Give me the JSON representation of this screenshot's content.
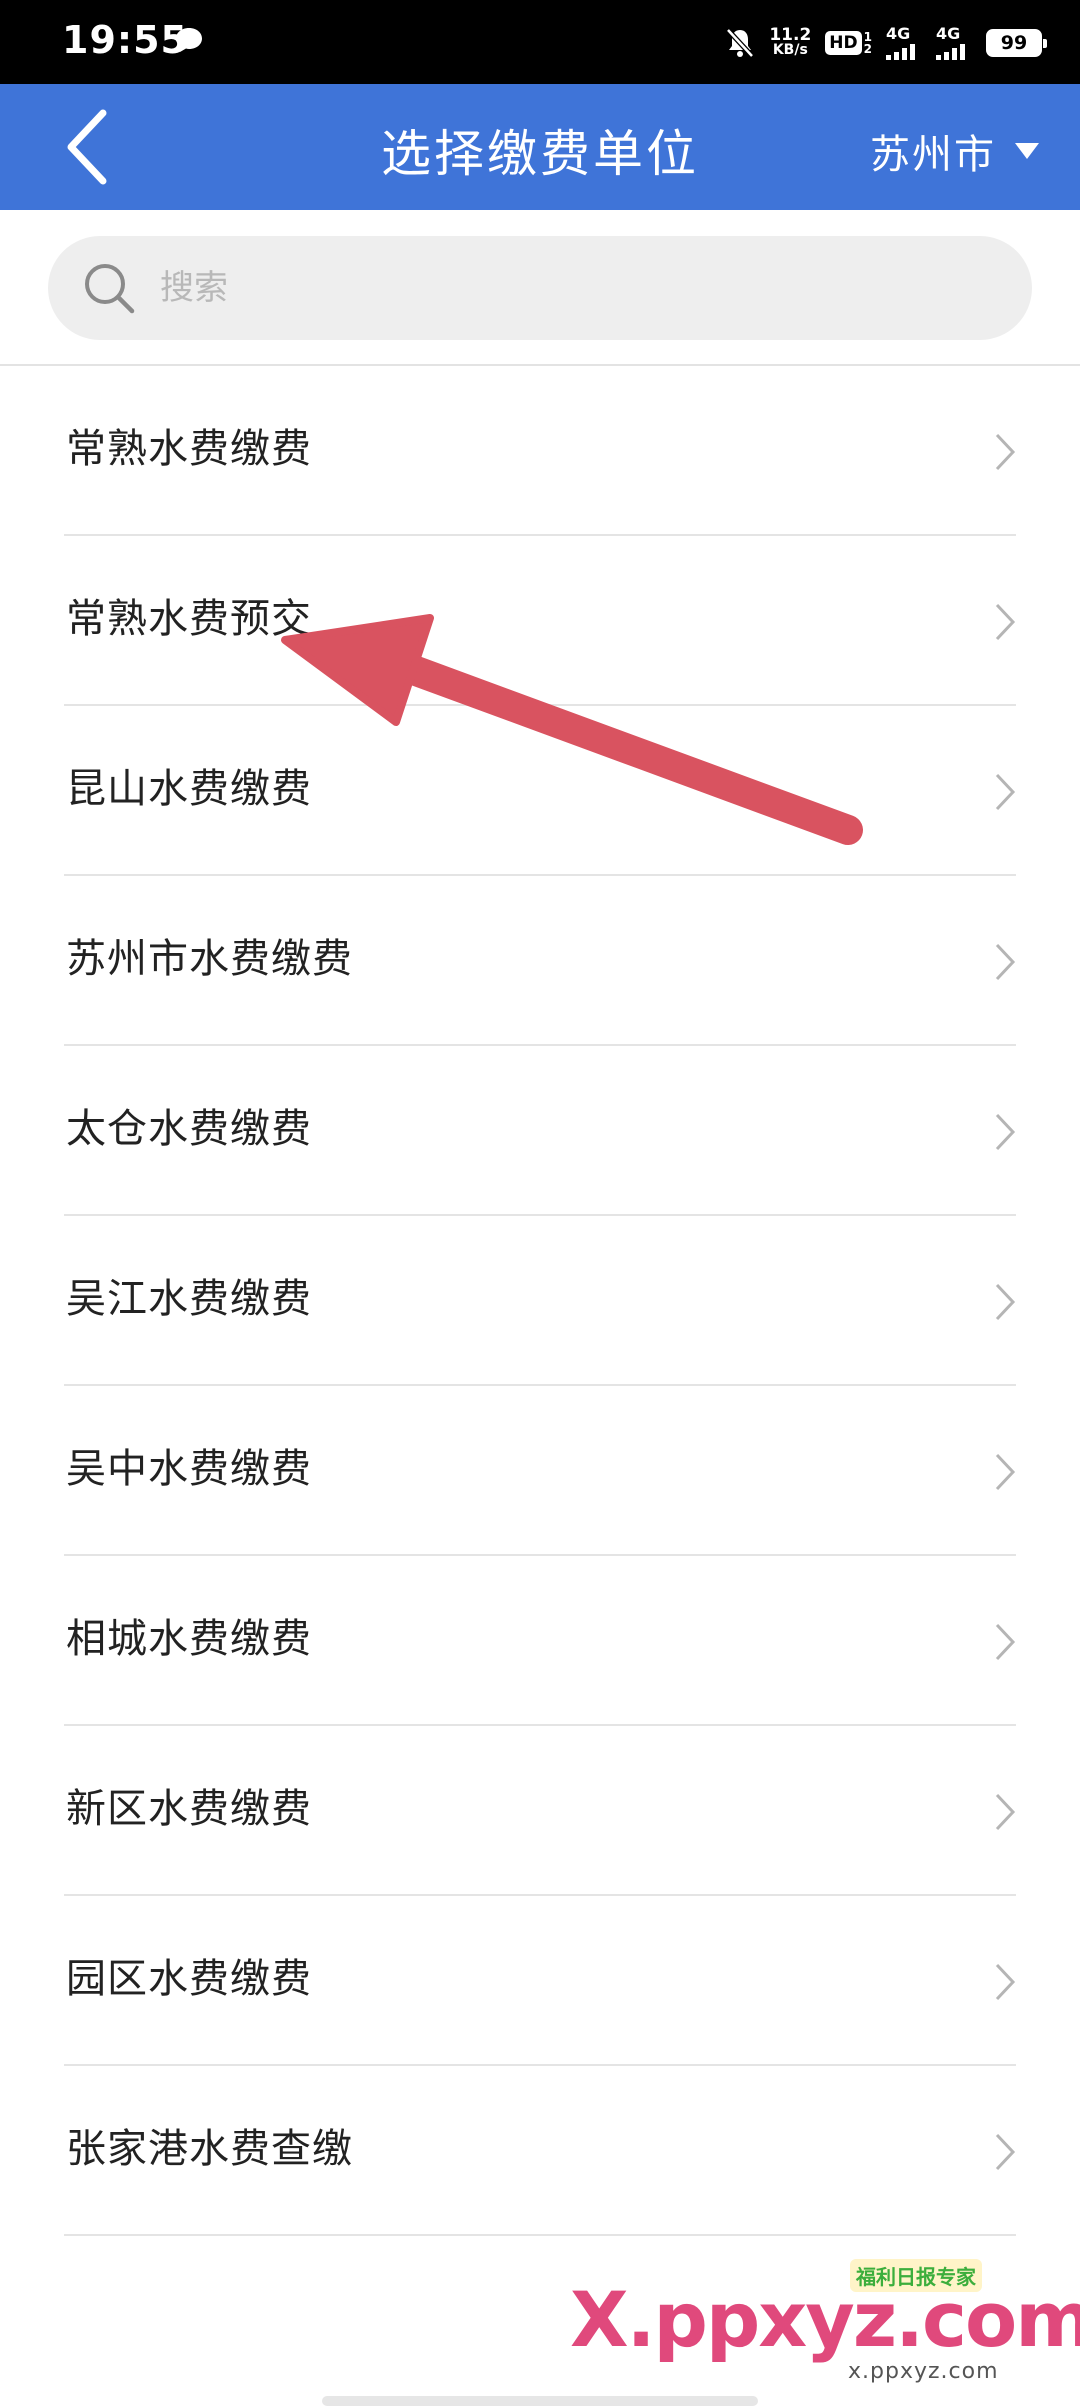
{
  "status_bar": {
    "time": "19:55",
    "speed_value": "11.2",
    "speed_unit": "KB/s",
    "hd_label": "HD",
    "hd_sub_top": "1",
    "hd_sub_bottom": "2",
    "net1_label": "4G",
    "net2_label": "4G",
    "battery": "99",
    "icons": [
      "chat-bubble-icon",
      "mute-bell-icon",
      "signal-icon",
      "signal-icon",
      "battery-icon"
    ]
  },
  "header": {
    "title": "选择缴费单位",
    "city": "苏州市",
    "back_icon": "chevron-left-icon",
    "dropdown_icon": "caret-down-icon",
    "background": "#3f74d8"
  },
  "search": {
    "placeholder": "搜索",
    "value": "",
    "icon": "search-icon"
  },
  "units": [
    {
      "label": "常熟水费缴费"
    },
    {
      "label": "常熟水费预交"
    },
    {
      "label": "昆山水费缴费"
    },
    {
      "label": "苏州市水费缴费"
    },
    {
      "label": "太仓水费缴费"
    },
    {
      "label": "吴江水费缴费"
    },
    {
      "label": "吴中水费缴费"
    },
    {
      "label": "相城水费缴费"
    },
    {
      "label": "新区水费缴费"
    },
    {
      "label": "园区水费缴费"
    },
    {
      "label": "张家港水费查缴"
    }
  ],
  "annotation": {
    "type": "arrow",
    "color": "#d95360",
    "points_to": "常熟水费预交"
  },
  "watermark": {
    "text": "X.ppxyz.com",
    "badge": "福利日报专家",
    "url": "x.ppxyz.com"
  }
}
